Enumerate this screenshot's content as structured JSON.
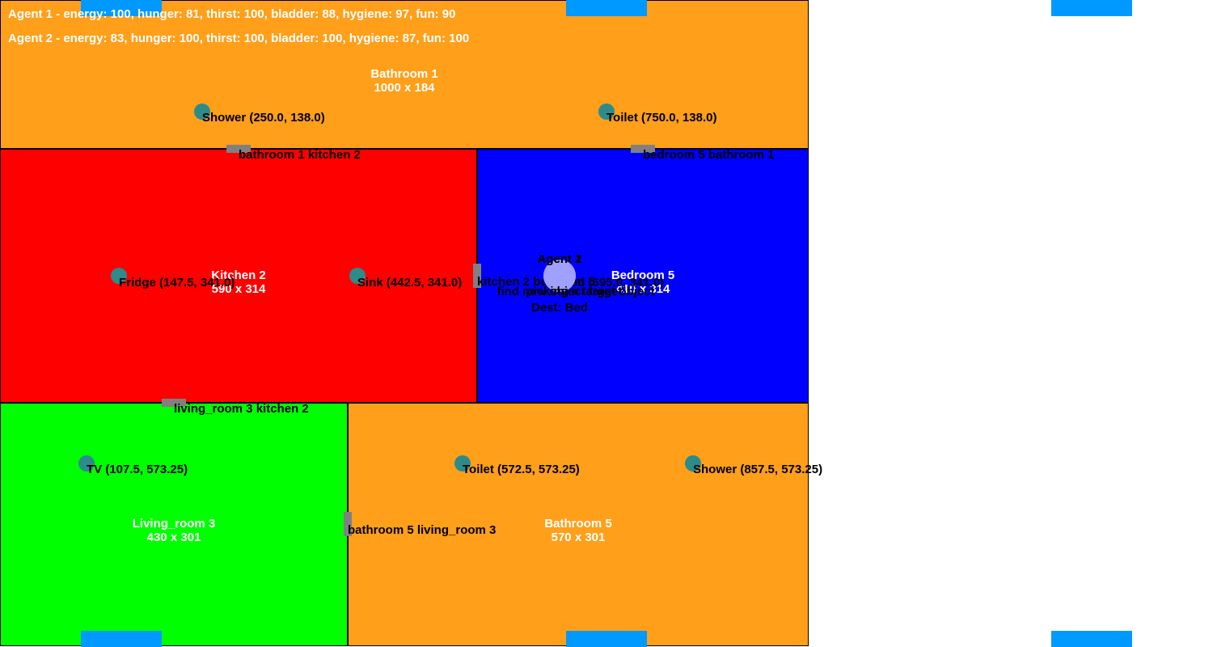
{
  "colors": {
    "bathroom": "#ff9f1a",
    "kitchen": "#ff0000",
    "bedroom": "#0000ff",
    "living_room": "#00ff00",
    "object": "#2e8b8b",
    "door": "#808080",
    "window": "#0099ff",
    "agent": "#a0a0ff"
  },
  "status": {
    "agent1": "Agent 1 - energy: 100, hunger: 81, thirst: 100, bladder: 88, hygiene: 97, fun: 90",
    "agent2": "Agent 2 - energy: 83, hunger: 100, thirst: 100, bladder: 100, hygiene: 87, fun: 100"
  },
  "rooms": {
    "bathroom1": {
      "name": "Bathroom 1",
      "size": "1000 x 184"
    },
    "kitchen2": {
      "name": "Kitchen 2",
      "size": "590 x 314"
    },
    "bedroom5": {
      "name": "Bedroom 5",
      "size": "410 x 314"
    },
    "living_room3": {
      "name": "Living_room 3",
      "size": "430 x 301"
    },
    "bathroom5": {
      "name": "Bathroom 5",
      "size": "570 x 301"
    }
  },
  "objects": {
    "shower1": "Shower (250.0, 138.0)",
    "toilet1": "Toilet (750.0, 138.0)",
    "fridge": "Fridge (147.5, 341.0)",
    "sink": "Sink (442.5, 341.0)",
    "bed": "Bed (695.0, 341.0)",
    "tv": "TV (107.5, 573.25)",
    "toilet5": "Toilet (572.5, 573.25)",
    "shower5": "Shower (857.5, 573.25)"
  },
  "doors": {
    "bathroom1_kitchen2": "bathroom 1 kitchen 2",
    "bedroom5_bathroom1": "bedroom 5 bathroom 1",
    "kitchen2_bedroom5": "kitchen 2 bedroom 5",
    "living_room3_kitchen2": "living_room 3 kitchen 2",
    "bathroom5_living_room3": "bathroom 5 living_room 3"
  },
  "agents": {
    "agent1": {
      "name": "Agent 1",
      "action": "find new object target"
    },
    "agent2": {
      "name": "Agent 2",
      "action": "picking a target object",
      "dest": "Dest: Bed"
    }
  }
}
